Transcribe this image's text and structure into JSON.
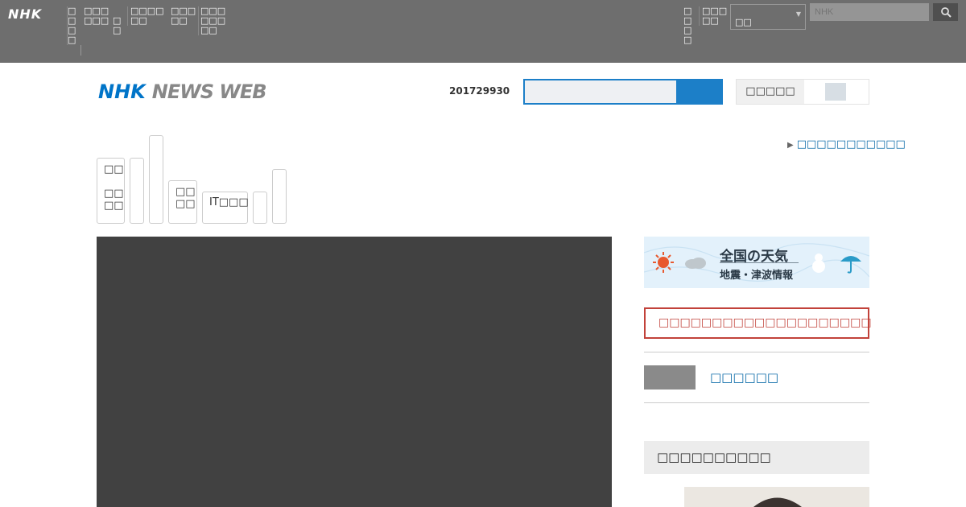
{
  "global_nav": {
    "logo": "NHK",
    "items": [
      "□□□□",
      "□□□□□□",
      "□□",
      "□□□□□□",
      "□□□□□",
      "□□□□□□□□",
      "□□□□",
      "□□□□□"
    ],
    "region_select": "□□",
    "search_placeholder": "NHK"
  },
  "header": {
    "logo_nhk": "NHK",
    "logo_newsweb": "NEWS WEB",
    "date": "201729930",
    "mode_label": "□□□□□"
  },
  "topic_link": "□□□□□□□□□□□",
  "tabs": [
    {
      "label": "□□\n\n□□\n□□"
    },
    {
      "label": ""
    },
    {
      "label": ""
    },
    {
      "label": "□□\n□□"
    },
    {
      "label": "IT□□□"
    },
    {
      "label": ""
    },
    {
      "label": ""
    }
  ],
  "sidebar": {
    "weather_title": "全国の天気",
    "weather_sub": "地震・津波情報",
    "alert_text": "□□□□□□□□□□□□□□□□□□□□",
    "link_text": "□□□□□□",
    "section_title": "□□□□□□□□□□"
  },
  "colors": {
    "brand_blue": "#0074c8",
    "alert_red": "#c2423a",
    "link_blue": "#0a6aa8"
  }
}
